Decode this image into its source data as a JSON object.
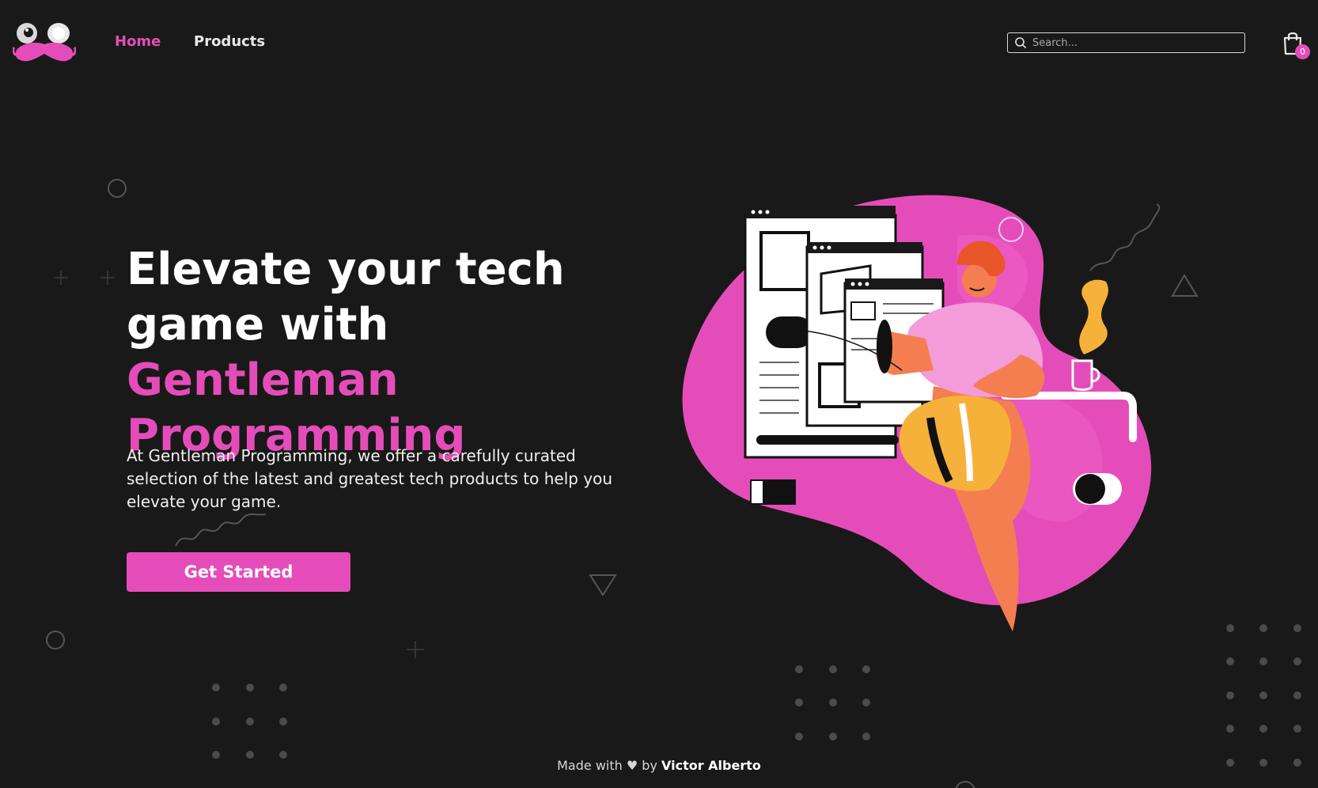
{
  "nav": {
    "home": "Home",
    "products": "Products",
    "search_placeholder": "Search...",
    "cart_count": "0"
  },
  "hero": {
    "title_line1": "Elevate your tech",
    "title_line2_plain": "game with ",
    "title_accent": "Gentleman Programming",
    "description": "At Gentleman Programming, we offer a carefully curated selection of the latest and greatest tech products to help you elevate your game.",
    "cta": "Get Started"
  },
  "footer": {
    "prefix": "Made with ♥ by",
    "author": "Victor Alberto"
  },
  "colors": {
    "background": "#1a1919",
    "accent": "#e44db9",
    "text": "#ffffff"
  },
  "icons": [
    "mustache-logo-icon",
    "search-icon",
    "shopping-bag-icon"
  ]
}
